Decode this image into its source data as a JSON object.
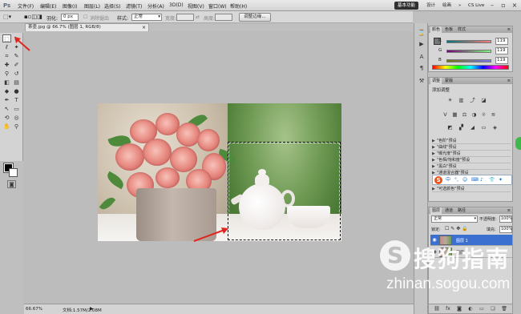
{
  "app": {
    "logo": "Ps"
  },
  "menu": [
    "文件(F)",
    "编辑(E)",
    "图像(I)",
    "图层(L)",
    "选择(S)",
    "滤镜(T)",
    "分析(A)",
    "3D(D)",
    "视图(V)",
    "窗口(W)",
    "帮助(H)"
  ],
  "workspace": {
    "basic": "基本功能",
    "design": "设计",
    "painting": "绘画",
    "more": "»",
    "cs_live": "CS Live"
  },
  "options": {
    "feather_label": "羽化:",
    "feather_value": "0 px",
    "antialias_label": "消除锯齿",
    "style_label": "样式:",
    "style_value": "正常",
    "width_label": "宽度:",
    "height_label": "高度:",
    "refine_button": "调整边缘..."
  },
  "document": {
    "tab_title": "茶壶.jpg @ 66.7% (图层 1, RGB/8)",
    "close": "×"
  },
  "status": {
    "zoom": "66.67%",
    "doc_info": "文档:1.57M/2.08M"
  },
  "color_panel": {
    "tabs": [
      "颜色",
      "色板",
      "样式"
    ],
    "channels": [
      {
        "letter": "R",
        "value": "119"
      },
      {
        "letter": "G",
        "value": "119"
      },
      {
        "letter": "B",
        "value": "119"
      }
    ],
    "fg_color": "#777777"
  },
  "adjust_panel": {
    "tabs": [
      "调整",
      "蒙版"
    ],
    "title": "添加调整",
    "presets": [
      "\"色阶\"预设",
      "\"曲线\"预设",
      "\"曝光度\"预设",
      "\"色相/饱和度\"预设",
      "\"黑白\"预设",
      "\"通道混合器\"预设",
      "\"可选颜色\"预设"
    ]
  },
  "sogou": {
    "logo": "S",
    "items": [
      "中",
      "°,",
      "☺",
      "⌨",
      "♪",
      "👕",
      "✦"
    ]
  },
  "layers_panel": {
    "tabs": [
      "图层",
      "通道",
      "路径"
    ],
    "blend_mode": "正常",
    "opacity_label": "不透明度:",
    "opacity_value": "100%",
    "lock_label": "锁定:",
    "fill_label": "填充:",
    "fill_value": "100%",
    "layers": [
      {
        "name": "图层 1",
        "selected": true
      },
      {
        "name": "图层 0",
        "selected": false
      }
    ]
  },
  "watermark": {
    "symbol": "S",
    "text": "搜狗指南",
    "url": "zhinan.sogou.com"
  },
  "colors": {
    "accent_selected_layer": "#3b6fd0",
    "arrow": "#e0261f",
    "menu_active": "#2f2f2f"
  }
}
